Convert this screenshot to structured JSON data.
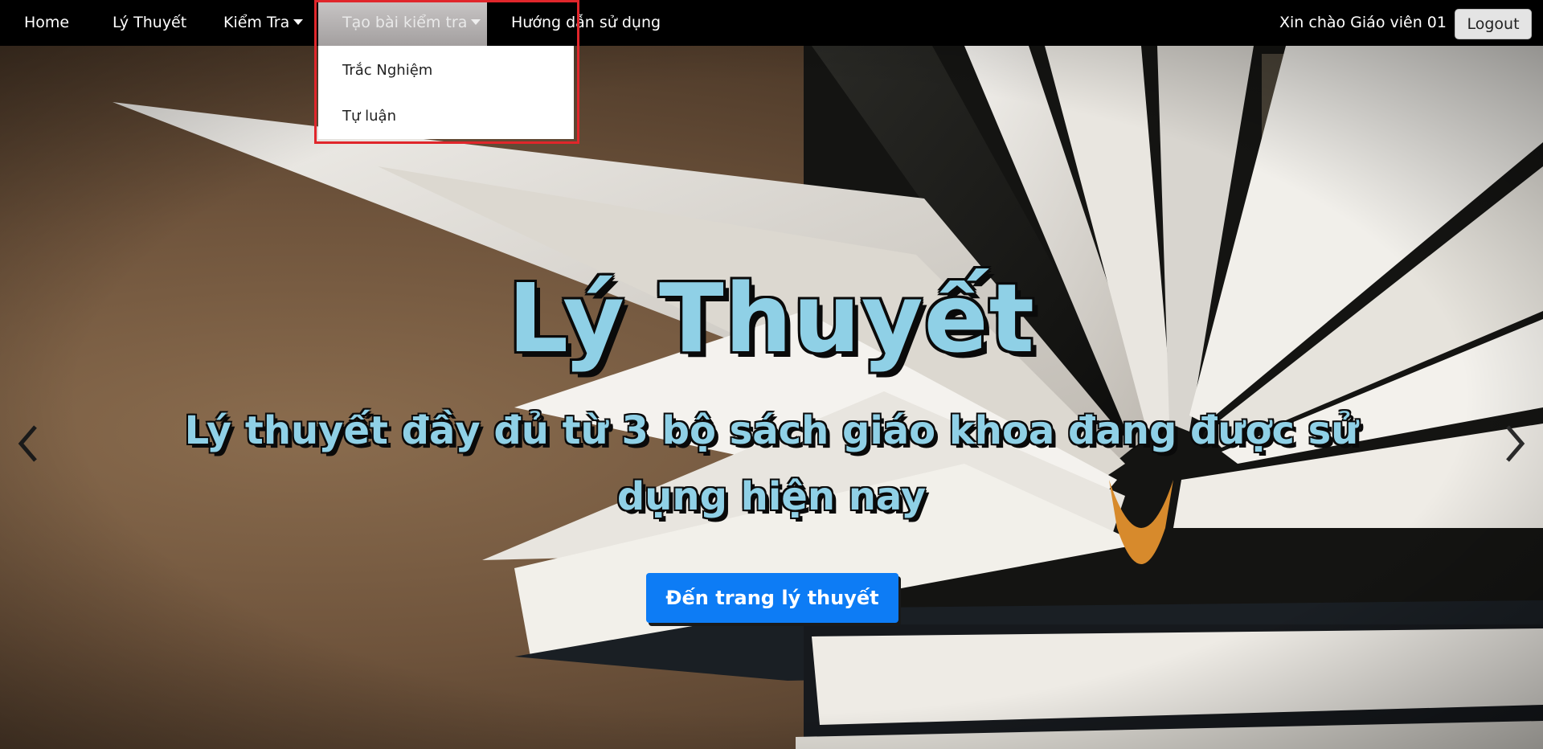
{
  "navbar": {
    "items": [
      {
        "label": "Home"
      },
      {
        "label": "Lý Thuyết"
      },
      {
        "label": "Kiểm Tra"
      },
      {
        "label": "Tạo bài kiểm tra"
      },
      {
        "label": "Hướng dẫn sử dụng"
      }
    ],
    "greeting": "Xin chào Giáo viên 01",
    "logout_label": "Logout"
  },
  "dropdown": {
    "items": [
      {
        "label": "Trắc Nghiệm"
      },
      {
        "label": "Tự luận"
      }
    ]
  },
  "hero": {
    "title": "Lý Thuyết",
    "subtitle": "Lý thuyết đầy đủ từ 3 bộ sách giáo khoa đang được sử dụng hiện nay",
    "cta_label": "Đến trang lý thuyết"
  },
  "icons": {
    "prev": "chevron-left-icon",
    "next": "chevron-right-icon",
    "caret": "caret-down-icon"
  },
  "colors": {
    "navbar_bg": "#000000",
    "accent_blue": "#0d7cf5",
    "title_text": "#8fd0e6",
    "highlight_border": "#e0262b"
  }
}
